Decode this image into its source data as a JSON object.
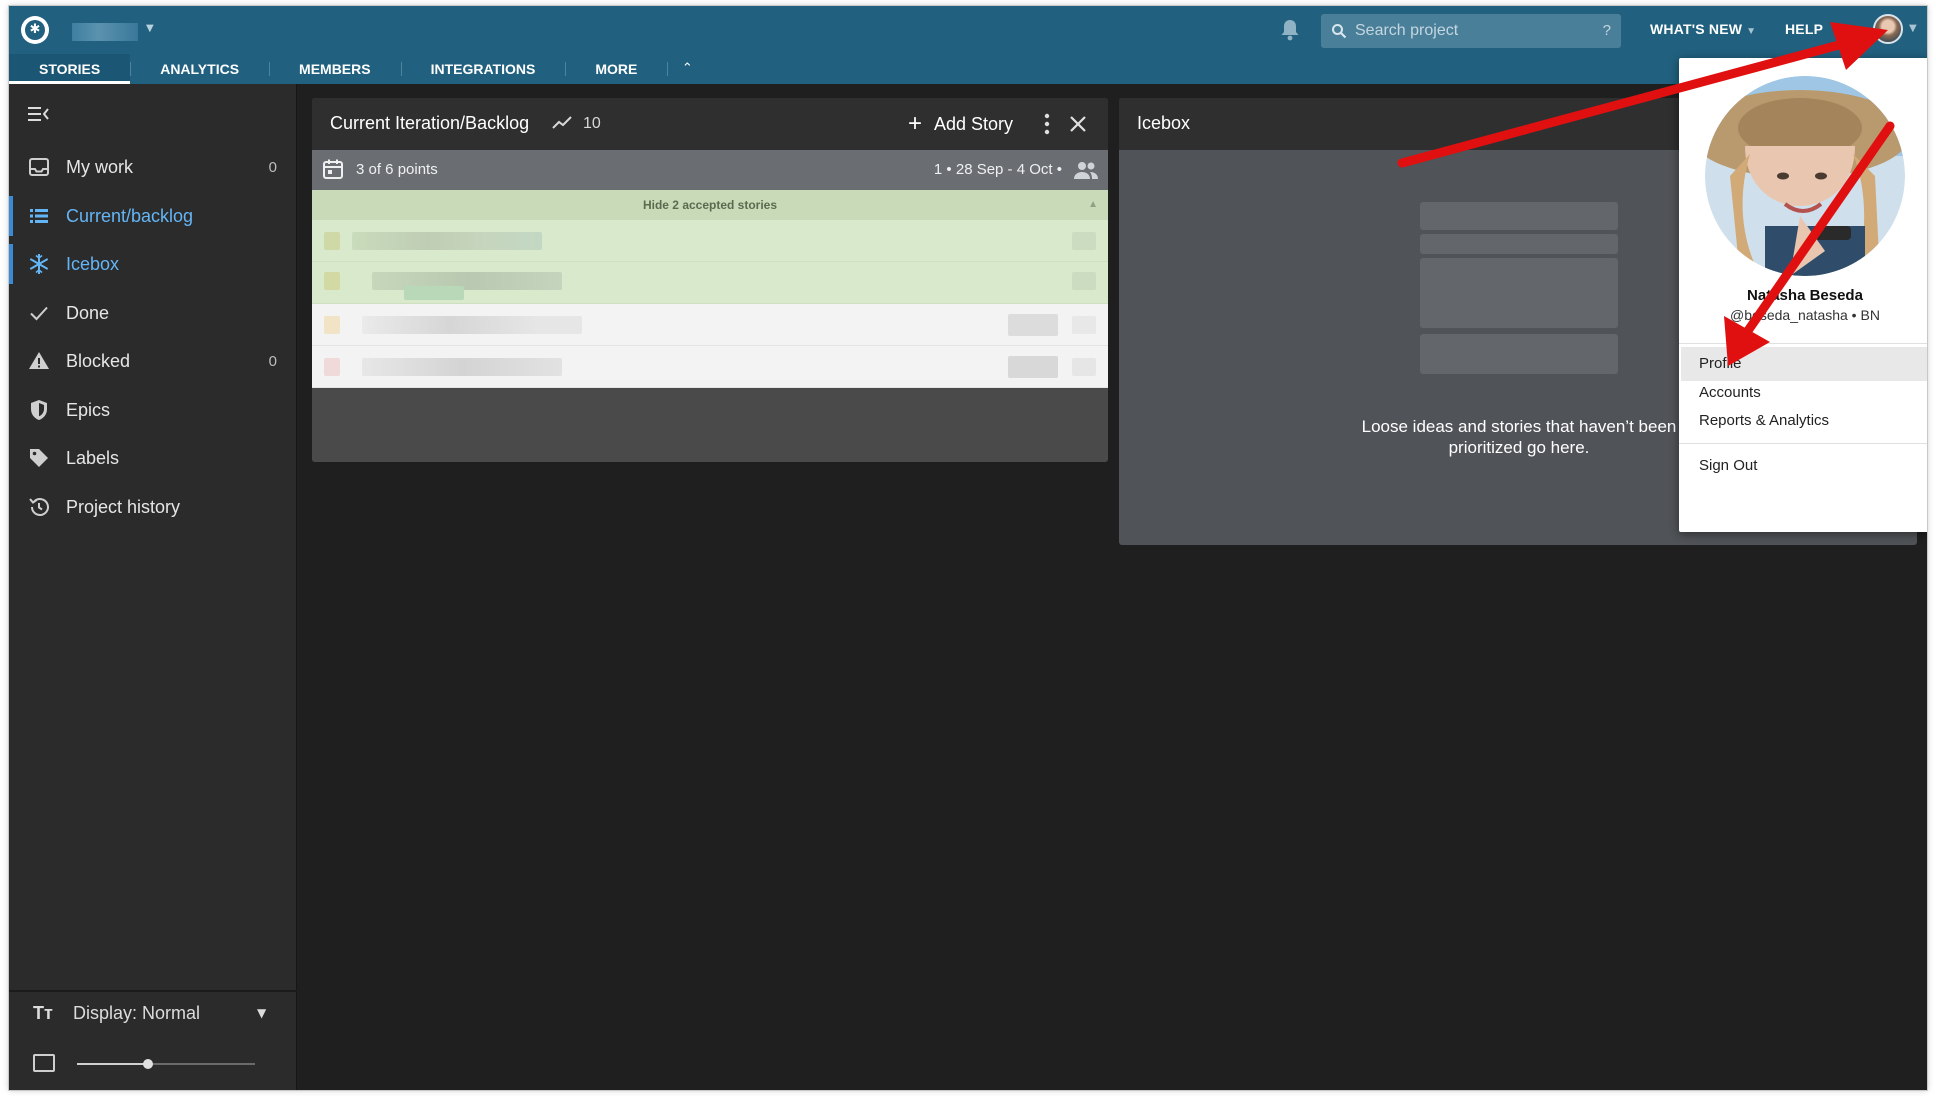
{
  "header": {
    "tabs": [
      "STORIES",
      "ANALYTICS",
      "MEMBERS",
      "INTEGRATIONS",
      "MORE"
    ],
    "search_placeholder": "Search project",
    "search_help": "?",
    "whats_new": "WHAT'S NEW",
    "help": "HELP"
  },
  "sidebar": {
    "items": [
      {
        "label": "My work",
        "count": "0",
        "icon": "inbox-icon"
      },
      {
        "label": "Current/backlog",
        "count": "",
        "icon": "list-icon"
      },
      {
        "label": "Icebox",
        "count": "",
        "icon": "snowflake-icon"
      },
      {
        "label": "Done",
        "count": "",
        "icon": "check-icon"
      },
      {
        "label": "Blocked",
        "count": "0",
        "icon": "warning-icon"
      },
      {
        "label": "Epics",
        "count": "",
        "icon": "shield-icon"
      },
      {
        "label": "Labels",
        "count": "",
        "icon": "tag-icon"
      },
      {
        "label": "Project history",
        "count": "",
        "icon": "history-icon"
      }
    ],
    "selected": [
      "Current/backlog",
      "Icebox"
    ],
    "display_label": "Display: Normal",
    "zoom_level": 0.4
  },
  "backlog": {
    "title": "Current Iteration/Backlog",
    "velocity": "10",
    "add_story": "Add Story",
    "points": "3 of 6 points",
    "iteration": "1 • 28 Sep - 4 Oct •",
    "hide_accepted": "Hide 2 accepted stories"
  },
  "icebox": {
    "title": "Icebox",
    "message": "Loose ideas and stories that haven’t been prioritized go here."
  },
  "profile_menu": {
    "name": "Natasha Beseda",
    "handle": "@beseda_natasha  •  BN",
    "items": [
      "Profile",
      "Accounts",
      "Reports & Analytics",
      "Sign Out"
    ],
    "highlighted": "Profile"
  },
  "colors": {
    "header": "#21617f",
    "accent": "#64b5f6",
    "annotation_arrow": "#e01010",
    "accepted_story": "#d9e9cc"
  }
}
